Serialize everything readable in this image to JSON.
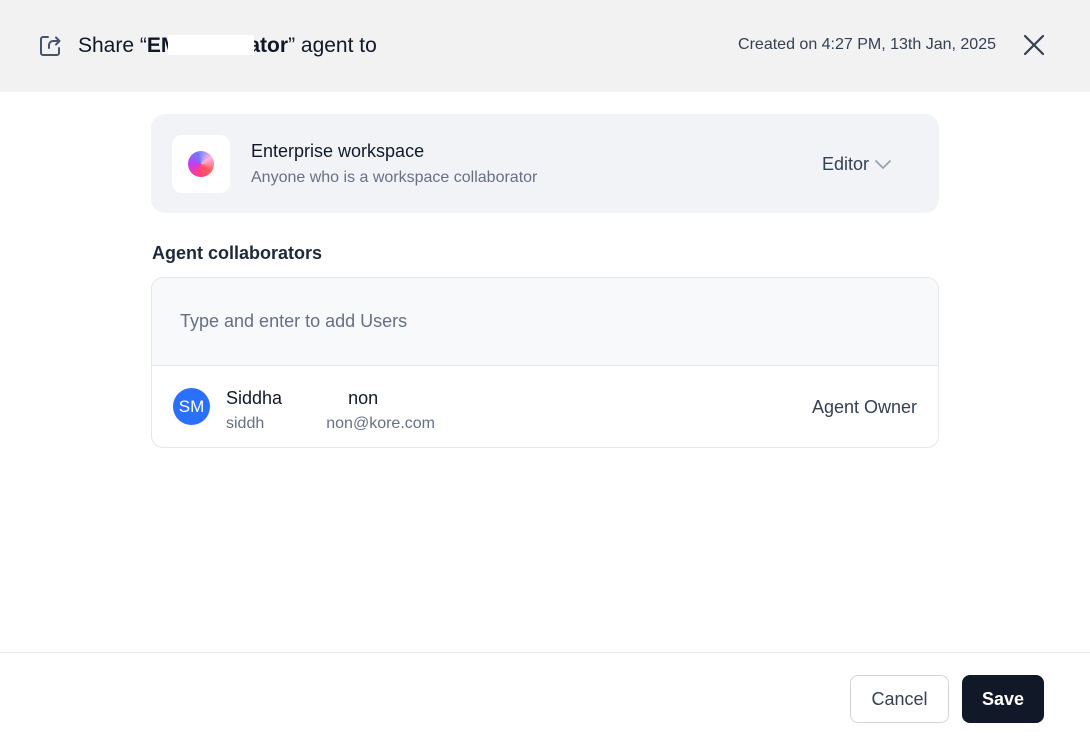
{
  "header": {
    "title_prefix": "Share “",
    "agent_name_start": "EM",
    "agent_name_end": "ator",
    "title_suffix": "” agent to",
    "created": "Created on 4:27 PM, 13th Jan, 2025",
    "share_icon": "share-icon",
    "close_icon": "close-icon"
  },
  "workspace": {
    "name": "Enterprise workspace",
    "description": "Anyone who is a workspace collaborator",
    "role": "Editor",
    "logo_icon": "workspace-logo-icon"
  },
  "collaborators": {
    "title": "Agent collaborators",
    "input_placeholder": "Type and enter to add Users",
    "users": [
      {
        "initials": "SM",
        "name_start": "Siddha",
        "name_end": "non",
        "email_start": "siddh",
        "email_end": "non@kore.com",
        "role": "Agent Owner"
      }
    ]
  },
  "footer": {
    "cancel_label": "Cancel",
    "save_label": "Save"
  },
  "colors": {
    "header_bg": "#f2f2f3",
    "card_bg": "#f2f3f6",
    "avatar": "#2970ff",
    "save_button": "#111827"
  }
}
